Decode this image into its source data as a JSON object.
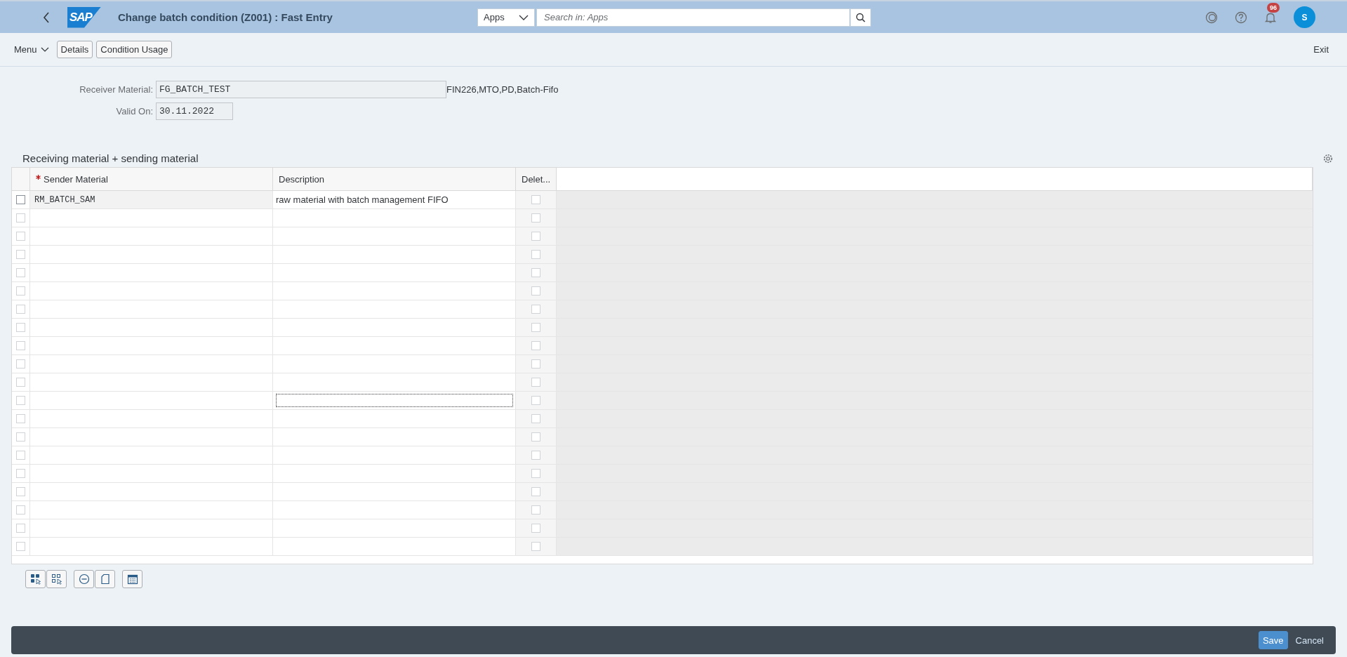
{
  "shell": {
    "logo_text": "SAP",
    "title": "Change batch condition (Z001) : Fast Entry",
    "search_scope": "Apps",
    "search_placeholder": "Search in: Apps",
    "notification_count": "96",
    "user_initial": "S"
  },
  "toolbar": {
    "menu": "Menu",
    "buttons": [
      "Details",
      "Condition Usage"
    ],
    "exit": "Exit"
  },
  "form": [
    {
      "label": "Receiver Material:",
      "value": "FG_BATCH_TEST",
      "kind": "wide",
      "note": "FIN226,MTO,PD,Batch-Fifo"
    },
    {
      "label": "Valid On:",
      "value": "30.11.2022",
      "kind": "narrow"
    }
  ],
  "table": {
    "title": "Receiving material + sending material",
    "columns": [
      {
        "label": "Sender Material",
        "required": true
      },
      {
        "label": "Description",
        "required": false
      },
      {
        "label": "Delet...",
        "required": false
      }
    ],
    "rows": [
      {
        "sender_material": "RM_BATCH_SAM",
        "description": "raw material with batch management FIFO",
        "selected": false,
        "delete_checked": false,
        "disabled": false,
        "focused": false
      },
      {
        "selected": false,
        "delete_checked": false,
        "disabled": true,
        "focused": false
      },
      {
        "selected": false,
        "delete_checked": false,
        "disabled": true,
        "focused": false
      },
      {
        "selected": false,
        "delete_checked": false,
        "disabled": true,
        "focused": false
      },
      {
        "selected": false,
        "delete_checked": false,
        "disabled": true,
        "focused": false
      },
      {
        "selected": false,
        "delete_checked": false,
        "disabled": true,
        "focused": false
      },
      {
        "selected": false,
        "delete_checked": false,
        "disabled": true,
        "focused": false
      },
      {
        "selected": false,
        "delete_checked": false,
        "disabled": true,
        "focused": false
      },
      {
        "selected": false,
        "delete_checked": false,
        "disabled": true,
        "focused": false
      },
      {
        "selected": false,
        "delete_checked": false,
        "disabled": true,
        "focused": false
      },
      {
        "selected": false,
        "delete_checked": false,
        "disabled": true,
        "focused": false
      },
      {
        "selected": false,
        "delete_checked": false,
        "disabled": true,
        "focused": true
      },
      {
        "selected": false,
        "delete_checked": false,
        "disabled": true,
        "focused": false
      },
      {
        "selected": false,
        "delete_checked": false,
        "disabled": true,
        "focused": false
      },
      {
        "selected": false,
        "delete_checked": false,
        "disabled": true,
        "focused": false
      },
      {
        "selected": false,
        "delete_checked": false,
        "disabled": true,
        "focused": false
      },
      {
        "selected": false,
        "delete_checked": false,
        "disabled": true,
        "focused": false
      },
      {
        "selected": false,
        "delete_checked": false,
        "disabled": true,
        "focused": false
      },
      {
        "selected": false,
        "delete_checked": false,
        "disabled": true,
        "focused": false
      },
      {
        "selected": false,
        "delete_checked": false,
        "disabled": true,
        "focused": false
      }
    ]
  },
  "footer": {
    "buttons": [
      {
        "label": "Save",
        "kind": "primary"
      },
      {
        "label": "Cancel",
        "kind": "plain"
      }
    ]
  }
}
